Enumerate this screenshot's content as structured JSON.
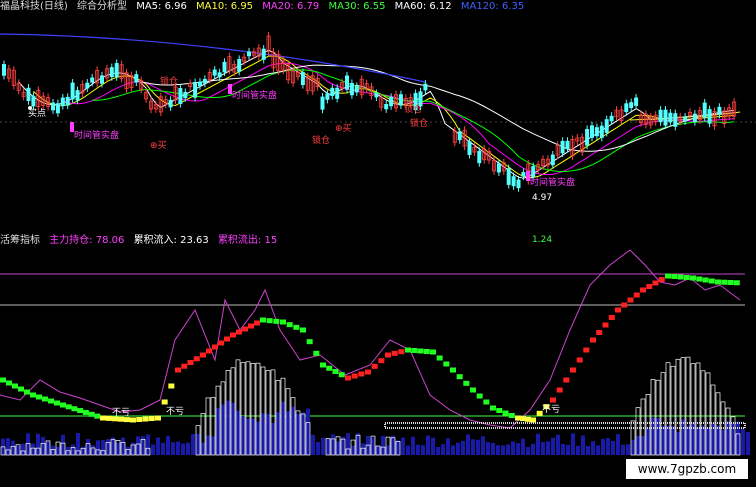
{
  "header": {
    "title": "福晶科技(日线)",
    "indicator_name": "综合分析型",
    "ma5": "MA5: 6.96",
    "ma10": "MA10: 6.95",
    "ma20": "MA20: 6.79",
    "ma30": "MA30: 6.55",
    "ma60": "MA60: 6.12",
    "ma120": "MA120: 6.35"
  },
  "sub_header": {
    "title": "活筹指标",
    "main_hold": "主力持仓: 78.06",
    "inflow": "累积流入: 23.63",
    "outflow": "累积流出: 15",
    "value_right": "1.24"
  },
  "annotations": {
    "buy_point": "买点",
    "lock_pos_1": "锁仓",
    "lock_pos_2": "锁仓",
    "lock_pos_3": "锁仓",
    "lock_pos_4": "锁仓",
    "hint_1": "时间管实盘",
    "hint_2": "时间管实盘",
    "hint_3": "时间管实盘",
    "buy_1": "⊕买",
    "buy_2": "⊕买",
    "low_price": "4.97",
    "no_loss_1": "不亏",
    "no_loss_2": "不亏",
    "no_loss_3": "不亏"
  },
  "watermark": "www.7gpzb.com",
  "colors": {
    "background": "#000000",
    "up_candle": "#ff4040",
    "down_candle": "#54ffff",
    "ma5": "#ffffff",
    "ma10": "#ffff00",
    "ma20": "#ff00ff",
    "ma30": "#00ff00",
    "ma60": "#ffffff",
    "ma120": "#4040ff",
    "rising": "#ff2020",
    "falling": "#20ff20",
    "purple_line": "#cc44cc"
  },
  "chart_data": [
    {
      "type": "candlestick",
      "title": "福晶科技(日线)",
      "low_marker": 4.97,
      "series_names": [
        "MA5",
        "MA10",
        "MA20",
        "MA30",
        "MA60",
        "MA120"
      ],
      "ma_latest": [
        6.96,
        6.95,
        6.79,
        6.55,
        6.12,
        6.35
      ]
    },
    {
      "type": "line",
      "title": "活筹指标",
      "series_names": [
        "主力持仓",
        "累积流入",
        "累积流出"
      ],
      "latest": [
        78.06,
        23.63,
        15
      ]
    }
  ]
}
